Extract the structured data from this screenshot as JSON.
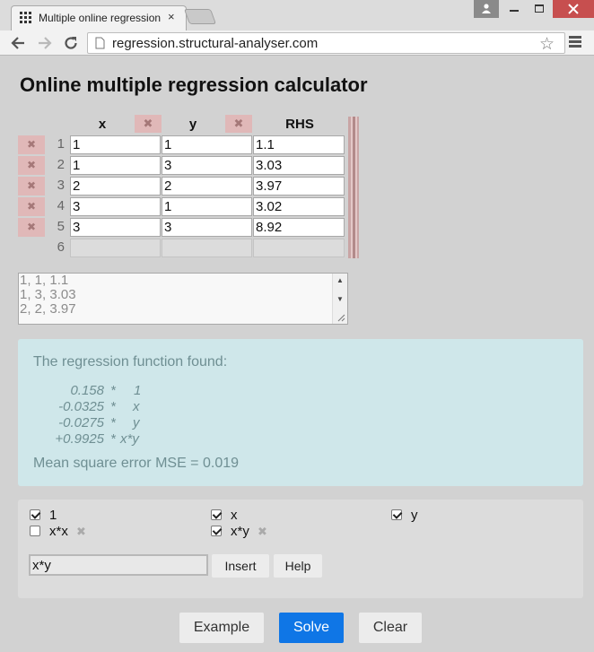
{
  "browser": {
    "tab_title": "Multiple online regression",
    "tab_close": "×",
    "url": "regression.structural-analyser.com",
    "icons": {
      "favicon": "grid-dots-icon",
      "back": "arrow-left-icon",
      "forward": "arrow-right-icon",
      "reload": "reload-icon",
      "page": "page-icon",
      "bookmark": "star-icon",
      "menu": "hamburger-menu-icon",
      "user": "user-icon",
      "minimize": "minimize-icon",
      "maximize": "maximize-icon",
      "close": "close-icon"
    }
  },
  "page": {
    "title": "Online multiple regression calculator"
  },
  "grid": {
    "columns": [
      "x",
      "y",
      "RHS"
    ],
    "delete_glyph": "✖",
    "rows": [
      {
        "num": "1",
        "cells": [
          "1",
          "1",
          "1.1"
        ]
      },
      {
        "num": "2",
        "cells": [
          "1",
          "3",
          "3.03"
        ]
      },
      {
        "num": "3",
        "cells": [
          "2",
          "2",
          "3.97"
        ]
      },
      {
        "num": "4",
        "cells": [
          "3",
          "1",
          "3.02"
        ]
      },
      {
        "num": "5",
        "cells": [
          "3",
          "3",
          "8.92"
        ]
      },
      {
        "num": "6",
        "cells": [
          "",
          "",
          ""
        ]
      }
    ]
  },
  "csv": {
    "lines": [
      "1, 1, 1.1",
      "1, 3, 3.03",
      "2, 2, 3.97"
    ]
  },
  "result": {
    "heading": "The regression function found:",
    "times": "*",
    "terms": [
      {
        "coef": "0.158",
        "var": "1"
      },
      {
        "coef": "-0.0325",
        "var": "x"
      },
      {
        "coef": "-0.0275",
        "var": "y"
      },
      {
        "coef": "+0.9925",
        "var": "x*y"
      }
    ],
    "mse": "Mean square error MSE = 0.019"
  },
  "terms_panel": {
    "terms": [
      {
        "label": "1",
        "checked": true,
        "removable": false
      },
      {
        "label": "x",
        "checked": true,
        "removable": false
      },
      {
        "label": "y",
        "checked": true,
        "removable": false
      },
      {
        "label": "x*x",
        "checked": false,
        "removable": true
      },
      {
        "label": "x*y",
        "checked": true,
        "removable": true
      }
    ],
    "remove_glyph": "✖",
    "input_value": "x*y",
    "insert_label": "Insert",
    "help_label": "Help"
  },
  "actions": {
    "example_label": "Example",
    "solve_label": "Solve",
    "clear_label": "Clear"
  },
  "colors": {
    "accent_blue": "#0f76e6",
    "result_bg": "#cfe7ea",
    "delete_bg": "#e0b8b8"
  }
}
